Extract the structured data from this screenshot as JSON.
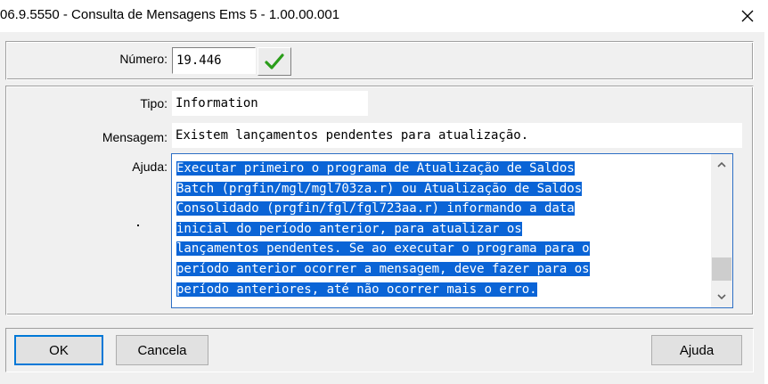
{
  "window": {
    "title": "06.9.5550 - Consulta de Mensagens Ems 5 - 1.00.00.001",
    "close_glyph": "✕"
  },
  "numero": {
    "label": "Número:",
    "value": "19.446",
    "confirm_glyph": "✔"
  },
  "tipo": {
    "label": "Tipo:",
    "value": "Information"
  },
  "mensagem": {
    "label": "Mensagem:",
    "value": "Existem lançamentos pendentes para atualização."
  },
  "ajuda_field": {
    "label": "Ajuda:",
    "lines": [
      "Executar primeiro o programa de Atualização de Saldos",
      "Batch (prgfin/mgl/mgl703za.r) ou Atualização de Saldos",
      "Consolidado (prgfin/fgl/fgl723aa.r) informando a data",
      "inicial do período anterior, para atualizar os",
      "lançamentos pendentes. Se ao executar o programa para o",
      "período anterior ocorrer a mensagem, deve fazer para os",
      "período anteriores, até não ocorrer mais o erro."
    ]
  },
  "buttons": {
    "ok": "OK",
    "cancela": "Cancela",
    "ajuda": "Ajuda"
  },
  "colors": {
    "selection": "#0a64d6",
    "confirm_green": "#2a9d1a"
  }
}
